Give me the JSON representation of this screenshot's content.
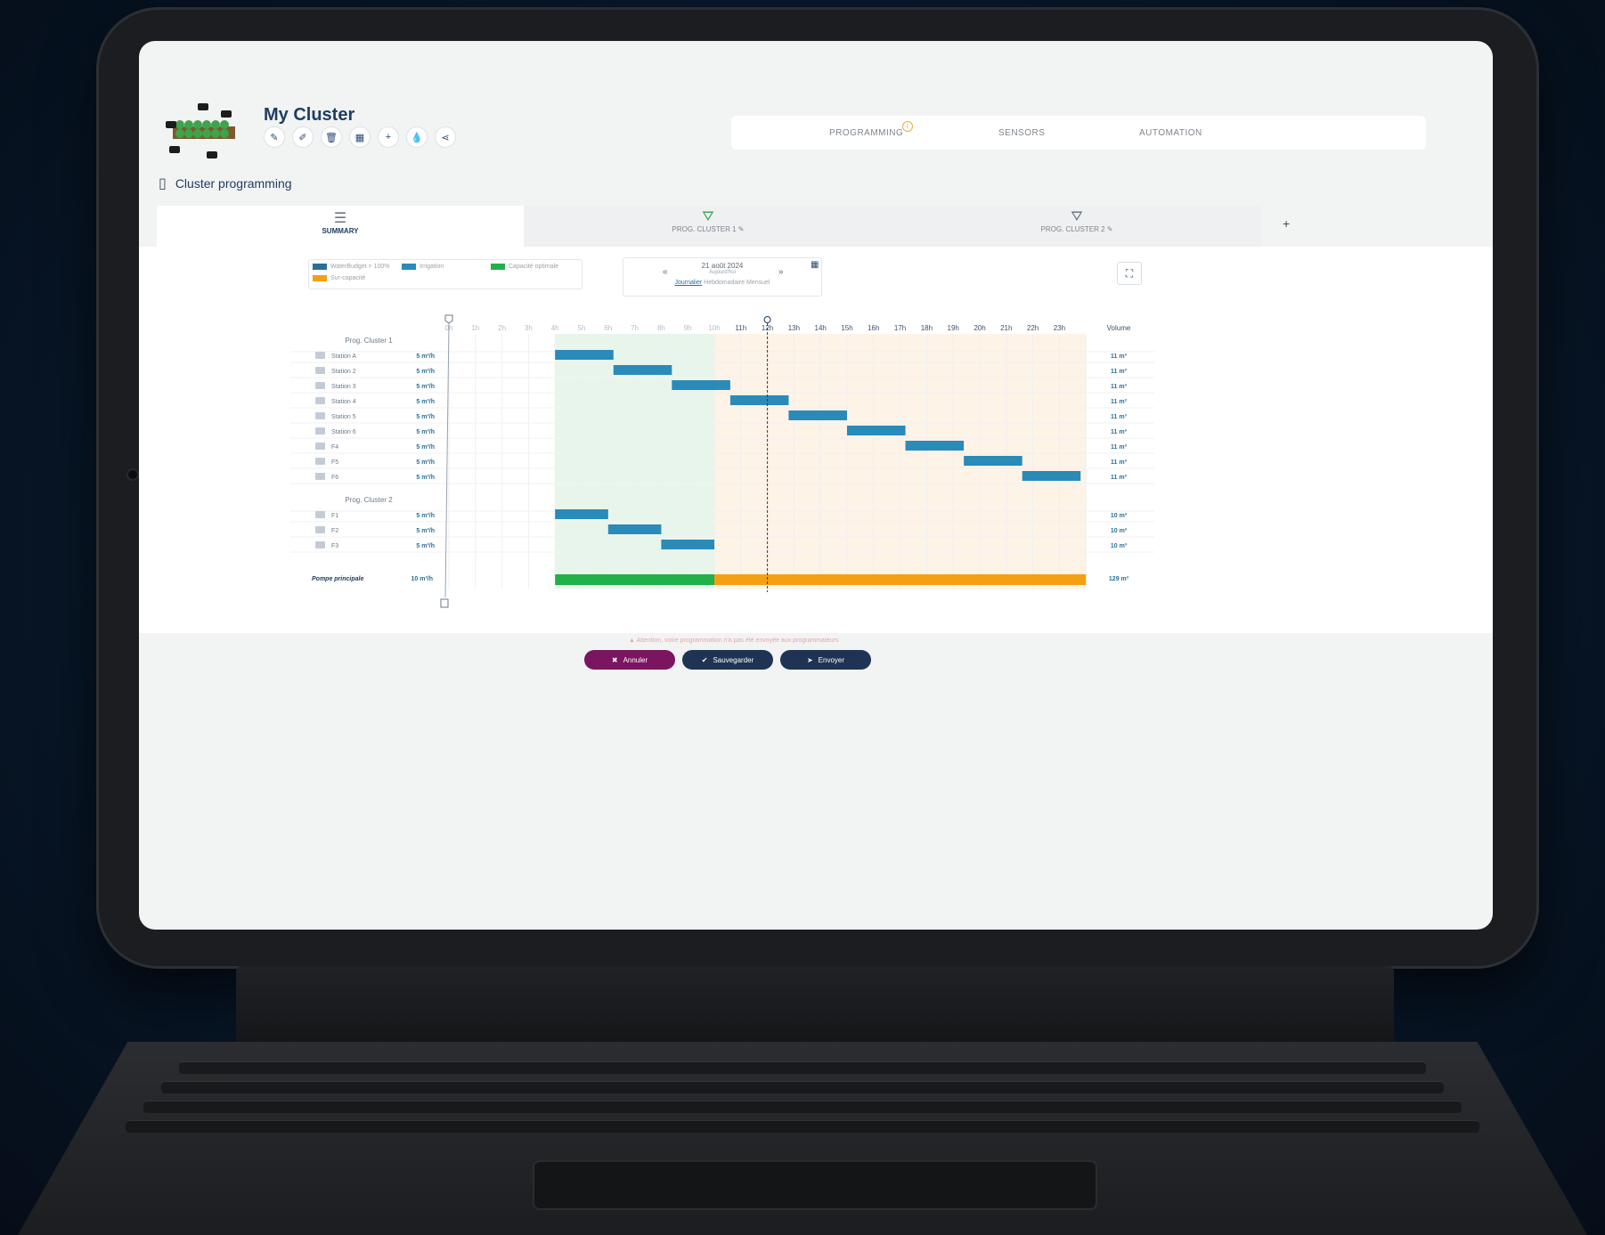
{
  "header": {
    "title": "My Cluster",
    "tool_icons": [
      "edit-icon",
      "pencil-icon",
      "trash-icon",
      "table-icon",
      "plus-icon",
      "drop-icon",
      "share-icon"
    ]
  },
  "topnav": {
    "items": [
      {
        "label": "PROGRAMMING",
        "badge": "i"
      },
      {
        "label": "SENSORS"
      },
      {
        "label": "AUTOMATION"
      }
    ]
  },
  "section": {
    "title": "Cluster programming"
  },
  "tabs": [
    {
      "label": "SUMMARY",
      "icon": "gantt-icon"
    },
    {
      "label": "PROG. CLUSTER 1",
      "icon": "drop-icon"
    },
    {
      "label": "PROG. CLUSTER 2",
      "icon": "drop-icon"
    }
  ],
  "add_tab": "+",
  "legend": [
    {
      "label": "WaterBudget > 100%",
      "color": "#2a6f9a"
    },
    {
      "label": "Irrigation",
      "color": "#2a8ab8"
    },
    {
      "label": "Capacité optimale",
      "color": "#22b04b"
    },
    {
      "label": "Sur-capacité",
      "color": "#f4a014"
    }
  ],
  "date": {
    "prev": "«",
    "next": "»",
    "date": "21 août 2024",
    "sub": "Aujourd'hui",
    "views": [
      "Journalier",
      "Hebdomadaire",
      "Mensuel"
    ]
  },
  "chart_data": {
    "type": "gantt",
    "hours": [
      "0h",
      "1h",
      "2h",
      "3h",
      "4h",
      "5h",
      "6h",
      "7h",
      "8h",
      "9h",
      "10h",
      "11h",
      "12h",
      "13h",
      "14h",
      "15h",
      "16h",
      "17h",
      "18h",
      "19h",
      "20h",
      "21h",
      "22h",
      "23h"
    ],
    "volume_label": "Volume",
    "now_hour": 12,
    "zones": [
      {
        "name": "Capacité optimale",
        "start": 4,
        "end": 10,
        "color": "#e8f5eb"
      },
      {
        "name": "Sur-capacité",
        "start": 10,
        "end": 24,
        "color": "#fdf3e6"
      }
    ],
    "groups": [
      {
        "name": "Prog. Cluster 1",
        "rows": [
          {
            "name": "Station A",
            "flow": "5 m³/h",
            "start": 4.0,
            "end": 6.2,
            "volume": "11 m³"
          },
          {
            "name": "Station 2",
            "flow": "5 m³/h",
            "start": 6.2,
            "end": 8.4,
            "volume": "11 m³"
          },
          {
            "name": "Station 3",
            "flow": "5 m³/h",
            "start": 8.4,
            "end": 10.6,
            "volume": "11 m³"
          },
          {
            "name": "Station 4",
            "flow": "5 m³/h",
            "start": 10.6,
            "end": 12.8,
            "volume": "11 m³"
          },
          {
            "name": "Station 5",
            "flow": "5 m³/h",
            "start": 12.8,
            "end": 15.0,
            "volume": "11 m³"
          },
          {
            "name": "Station 6",
            "flow": "5 m³/h",
            "start": 15.0,
            "end": 17.2,
            "volume": "11 m³"
          },
          {
            "name": "F4",
            "flow": "5 m³/h",
            "start": 17.2,
            "end": 19.4,
            "volume": "11 m³"
          },
          {
            "name": "F5",
            "flow": "5 m³/h",
            "start": 19.4,
            "end": 21.6,
            "volume": "11 m³"
          },
          {
            "name": "F6",
            "flow": "5 m³/h",
            "start": 21.6,
            "end": 23.8,
            "volume": "11 m³"
          }
        ]
      },
      {
        "name": "Prog. Cluster 2",
        "rows": [
          {
            "name": "F1",
            "flow": "5 m³/h",
            "start": 4.0,
            "end": 6.0,
            "volume": "10 m³"
          },
          {
            "name": "F2",
            "flow": "5 m³/h",
            "start": 6.0,
            "end": 8.0,
            "volume": "10 m³"
          },
          {
            "name": "F3",
            "flow": "5 m³/h",
            "start": 8.0,
            "end": 10.0,
            "volume": "10 m³"
          }
        ]
      }
    ],
    "pump": {
      "name": "Pompe principale",
      "flow": "10 m³/h",
      "segments": [
        {
          "start": 4,
          "end": 10,
          "color": "#22b04b"
        },
        {
          "start": 10,
          "end": 24,
          "color": "#f4a014"
        }
      ],
      "volume": "129 m³"
    }
  },
  "warning": "Attention, votre programmation n'a pas été envoyée aux programmateurs",
  "buttons": [
    {
      "label": "Annuler",
      "icon": "✖",
      "color": "#7a1560"
    },
    {
      "label": "Sauvegarder",
      "icon": "✔",
      "color": "#1f3354"
    },
    {
      "label": "Envoyer",
      "icon": "➤",
      "color": "#1f3354"
    }
  ]
}
